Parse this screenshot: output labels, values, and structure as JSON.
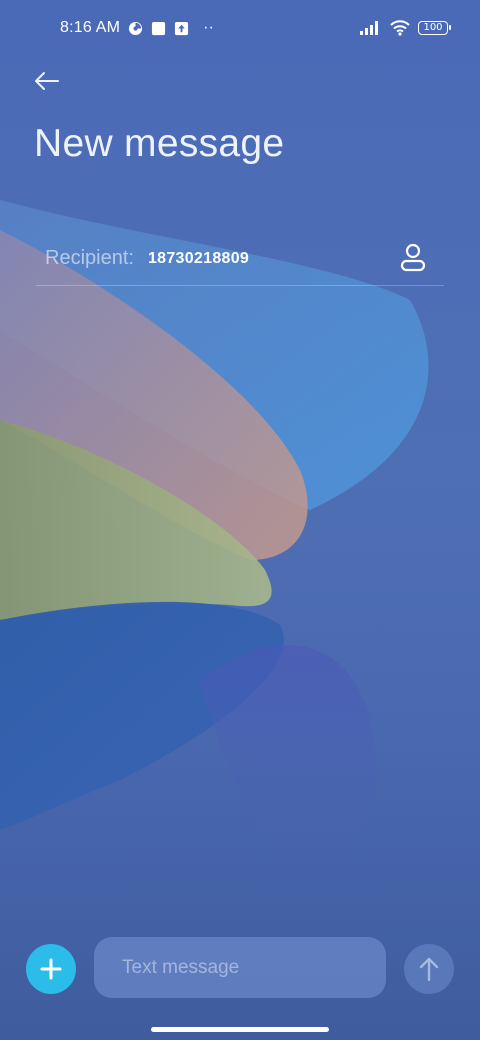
{
  "status_bar": {
    "time": "8:16 AM",
    "dots": "··",
    "battery": "100",
    "icons": [
      "notification-icon",
      "square-icon",
      "upload-icon",
      "signal-icon",
      "wifi-icon",
      "battery-icon"
    ]
  },
  "header": {
    "title": "New message",
    "back_icon": "arrow-left-icon"
  },
  "recipient": {
    "label": "Recipient:",
    "value": "18730218809",
    "contact_icon": "person-icon"
  },
  "composer": {
    "placeholder": "Text message",
    "add_icon": "plus-icon",
    "send_icon": "arrow-up-icon"
  },
  "colors": {
    "accent": "#2cbcea",
    "background": "#4a6ab8"
  }
}
